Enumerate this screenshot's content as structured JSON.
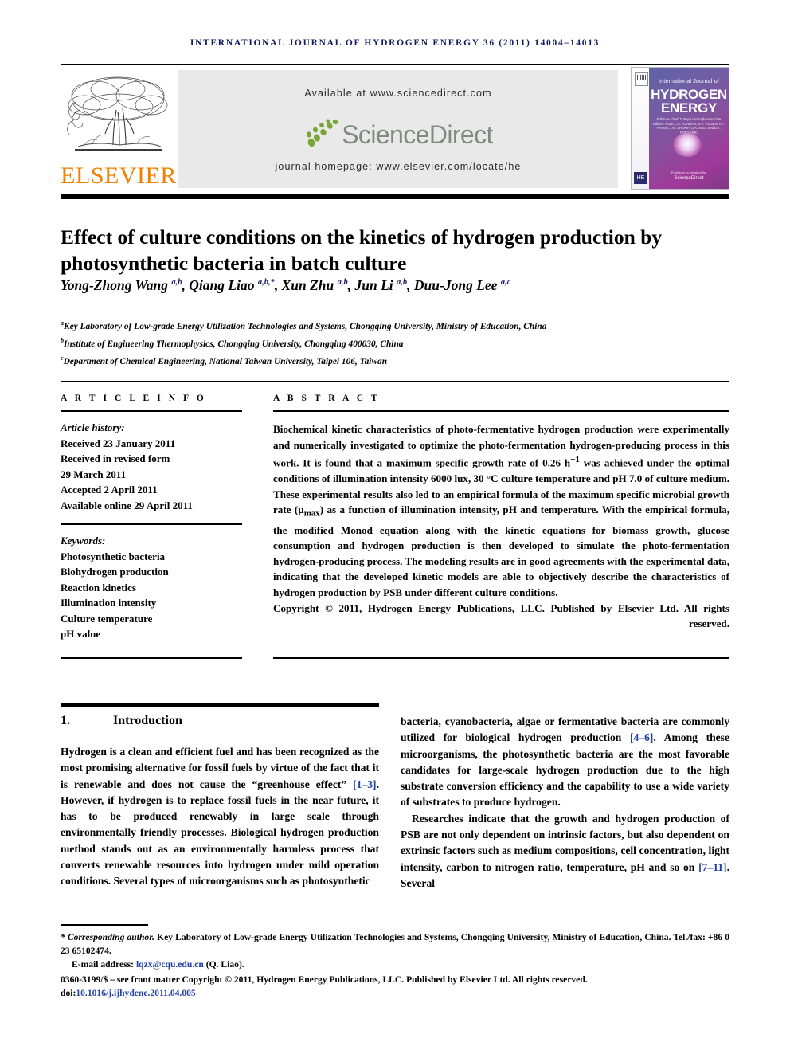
{
  "running_head": "INTERNATIONAL JOURNAL OF HYDROGEN ENERGY 36 (2011) 14004–14013",
  "banner": {
    "publisher_name": "ELSEVIER",
    "available_at": "Available at www.sciencedirect.com",
    "sciencedirect_wordmark": "ScienceDirect",
    "journal_homepage": "journal homepage: www.elsevier.com/locate/he",
    "cover": {
      "line_small": "International Journal of",
      "line1": "HYDROGEN",
      "line2": "ENERGY",
      "editors": "Editor-in-Chief:  T. Nejat Veziroğlu     Associate Editors:  NURI C.C. KURBAN, M.A. ROSEN, A.T. RAISSI, J.W. SHERIF, G.A. SAUL and B.K. POKSARIC",
      "hex_label": "HE",
      "sd_caption_top": "Published on behalf of the",
      "sd_caption": "ScienceDirect"
    }
  },
  "colors": {
    "elsevier_orange": "#f08000",
    "running_head_blue": "#141a5e",
    "citation_blue": "#1f3fa8",
    "sciencedirect_green": "#7aa637",
    "sciencedirect_gray": "#808b80",
    "panel_gray": "#e9e9e9"
  },
  "article": {
    "title": "Effect of culture conditions on the kinetics of hydrogen production by photosynthetic bacteria in batch culture",
    "authors_html": "Yong-Zhong Wang <sup>a,b</sup>, Qiang Liao <sup>a,b,*</sup>, Xun Zhu <sup>a,b</sup>, Jun Li <sup>a,b</sup>, Duu-Jong Lee <sup>a,c</sup>",
    "affiliations_html": "<sup>a</sup>Key Laboratory of Low-grade Energy Utilization Technologies and Systems, Chongqing University, Ministry of Education, China<br><sup>b</sup>Institute of Engineering Thermophysics, Chongqing University, Chongqing 400030, China<br><sup>c</sup>Department of Chemical Engineering, National Taiwan University, Taipei 106, Taiwan"
  },
  "article_info": {
    "heading": "A R T I C L E   I N F O",
    "history_label": "Article history:",
    "history": [
      "Received 23 January 2011",
      "Received in revised form",
      "29 March 2011",
      "Accepted 2 April 2011",
      "Available online 29 April 2011"
    ],
    "keywords_label": "Keywords:",
    "keywords": [
      "Photosynthetic bacteria",
      "Biohydrogen production",
      "Reaction kinetics",
      "Illumination intensity",
      "Culture temperature",
      "pH value"
    ]
  },
  "abstract": {
    "heading": "A B S T R A C T",
    "body_html": "Biochemical kinetic characteristics of photo-fermentative hydrogen production were experimentally and numerically investigated to optimize the photo-fermentation hydrogen-producing process in this work. It is found that a maximum specific growth rate of 0.26 h<sup>−1</sup> was achieved under the optimal conditions of illumination intensity 6000 lux, 30 °C culture temperature and pH 7.0 of culture medium. These experimental results also led to an empirical formula of the maximum specific microbial growth rate (μ<sub>max</sub>) as a function of illumination intensity, pH and temperature. With the empirical formula, the modified Monod equation along with the kinetic equations for biomass growth, glucose consumption and hydrogen production is then developed to simulate the photo-fermentation hydrogen-producing process. The modeling results are in good agreements with the experimental data, indicating that the developed kinetic models are able to objectively describe the characteristics of hydrogen production by PSB under different culture conditions.",
    "copyright": "Copyright © 2011, Hydrogen Energy Publications, LLC. Published by Elsevier Ltd. All rights reserved."
  },
  "introduction": {
    "number": "1.",
    "heading": "Introduction",
    "left_paragraph_html": "Hydrogen is a clean and efficient fuel and has been recognized as the most promising alternative for fossil fuels by virtue of the fact that it is renewable and does not cause the “greenhouse effect” <span class=\"cite\">[1–3]</span>. However, if hydrogen is to replace fossil fuels in the near future, it has to be produced renewably in large scale through environmentally friendly processes. Biological hydrogen production method stands out as an environmentally harmless process that converts renewable resources into hydrogen under mild operation conditions. Several types of microorganisms such as photosynthetic",
    "right_paragraph_1_html": "bacteria, cyanobacteria, algae or fermentative bacteria are commonly utilized for biological hydrogen production <span class=\"cite\">[4–6]</span>. Among these microorganisms, the photosynthetic bacteria are the most favorable candidates for large-scale hydrogen production due to the high substrate conversion efficiency and the capability to use a wide variety of substrates to produce hydrogen.",
    "right_paragraph_2_html": "Researches indicate that the growth and hydrogen production of PSB are not only dependent on intrinsic factors, but also dependent on extrinsic factors such as medium compositions, cell concentration, light intensity, carbon to nitrogen ratio, temperature, pH and so on <span class=\"cite\">[7–11]</span>. Several"
  },
  "footer": {
    "corresponding_html": "<span class=\"corr\">* Corresponding author.</span> Key Laboratory of Low-grade Energy Utilization Technologies and Systems, Chongqing University, Ministry of Education, China. Tel./fax: +86 0 23 65102474.",
    "email_html": "E-mail address: <span class=\"email\">lqzx@cqu.edu.cn</span> (Q. Liao).",
    "issn_line": "0360-3199/$ – see front matter Copyright © 2011, Hydrogen Energy Publications, LLC. Published by Elsevier Ltd. All rights reserved.",
    "doi_label": "doi:",
    "doi_value": "10.1016/j.ijhydene.2011.04.005"
  }
}
